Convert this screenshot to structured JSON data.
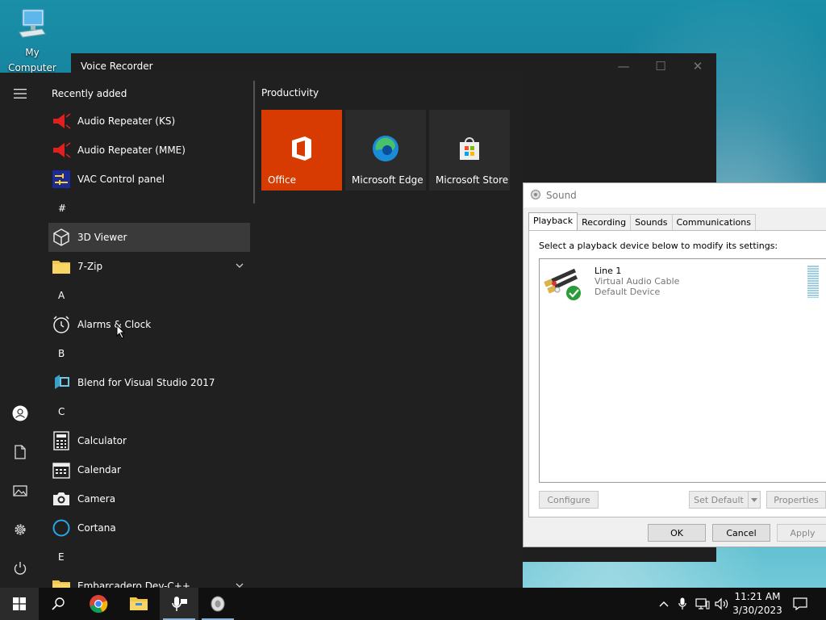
{
  "desktop": {
    "icon_label": "My Computer"
  },
  "voice_recorder": {
    "title": "Voice Recorder",
    "minimize": "—",
    "maximize": "☐",
    "close": "✕"
  },
  "start_menu": {
    "recently_added_title": "Recently added",
    "recent_apps": [
      {
        "label": "Audio Repeater (KS)",
        "icon": "speaker-red-icon"
      },
      {
        "label": "Audio Repeater (MME)",
        "icon": "speaker-red-icon"
      },
      {
        "label": "VAC Control panel",
        "icon": "vac-panel-icon"
      }
    ],
    "groups": [
      {
        "letter": "#",
        "apps": [
          {
            "label": "3D Viewer"
          },
          {
            "label": "7-Zip"
          }
        ]
      },
      {
        "letter": "A",
        "apps": [
          {
            "label": "Alarms & Clock"
          }
        ]
      },
      {
        "letter": "B",
        "apps": [
          {
            "label": "Blend for Visual Studio 2017"
          }
        ]
      },
      {
        "letter": "C",
        "apps": [
          {
            "label": "Calculator"
          },
          {
            "label": "Calendar"
          },
          {
            "label": "Camera"
          },
          {
            "label": "Cortana"
          }
        ]
      },
      {
        "letter": "E",
        "apps": [
          {
            "label": "Embarcadero Dev-C++"
          }
        ]
      }
    ],
    "tiles_group_title": "Productivity",
    "tiles": [
      {
        "label": "Office",
        "color": "#d83b01"
      },
      {
        "label": "Microsoft Edge",
        "color": "#2b2b2b"
      },
      {
        "label": "Microsoft Store",
        "color": "#2b2b2b"
      }
    ]
  },
  "sound_dialog": {
    "title": "Sound",
    "tabs": [
      "Playback",
      "Recording",
      "Sounds",
      "Communications"
    ],
    "instruction": "Select a playback device below to modify its settings:",
    "device": {
      "name": "Line 1",
      "driver": "Virtual Audio Cable",
      "status": "Default Device"
    },
    "buttons": {
      "configure": "Configure",
      "set_default": "Set Default",
      "properties": "Properties",
      "ok": "OK",
      "cancel": "Cancel",
      "apply": "Apply"
    }
  },
  "taskbar": {
    "clock_time": "11:21 AM",
    "clock_date": "3/30/2023"
  }
}
